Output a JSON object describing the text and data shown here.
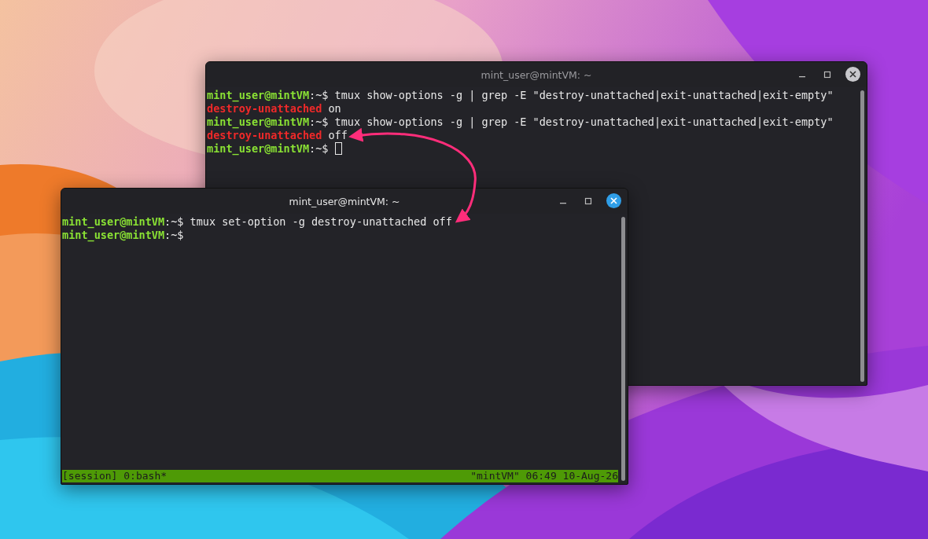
{
  "windows": [
    {
      "title": "mint_user@mintVM: ~",
      "focused": false,
      "lines": [
        [
          {
            "kind": "user",
            "text": "mint_user@mintVM"
          },
          {
            "kind": "plain",
            "text": ":~$ tmux show-options -g | grep -E \"destroy-unattached|exit-unattached|exit-empty\""
          }
        ],
        [
          {
            "kind": "error",
            "text": "destroy-unattached"
          },
          {
            "kind": "plain",
            "text": " on"
          }
        ],
        [
          {
            "kind": "user",
            "text": "mint_user@mintVM"
          },
          {
            "kind": "plain",
            "text": ":~$ tmux show-options -g | grep -E \"destroy-unattached|exit-unattached|exit-empty\""
          }
        ],
        [
          {
            "kind": "error",
            "text": "destroy-unattached"
          },
          {
            "kind": "plain",
            "text": " off"
          }
        ],
        [
          {
            "kind": "user",
            "text": "mint_user@mintVM"
          },
          {
            "kind": "plain",
            "text": ":~$ "
          },
          {
            "kind": "cursor"
          }
        ]
      ]
    },
    {
      "title": "mint_user@mintVM: ~",
      "focused": true,
      "lines": [
        [
          {
            "kind": "user",
            "text": "mint_user@mintVM"
          },
          {
            "kind": "plain",
            "text": ":~$ tmux set-option -g destroy-unattached off"
          }
        ],
        [
          {
            "kind": "user",
            "text": "mint_user@mintVM"
          },
          {
            "kind": "plain",
            "text": ":~$"
          }
        ]
      ],
      "status_bar": {
        "left": "[session] 0:bash*",
        "right": "\"mintVM\" 06:49 10-Aug-26"
      }
    }
  ]
}
